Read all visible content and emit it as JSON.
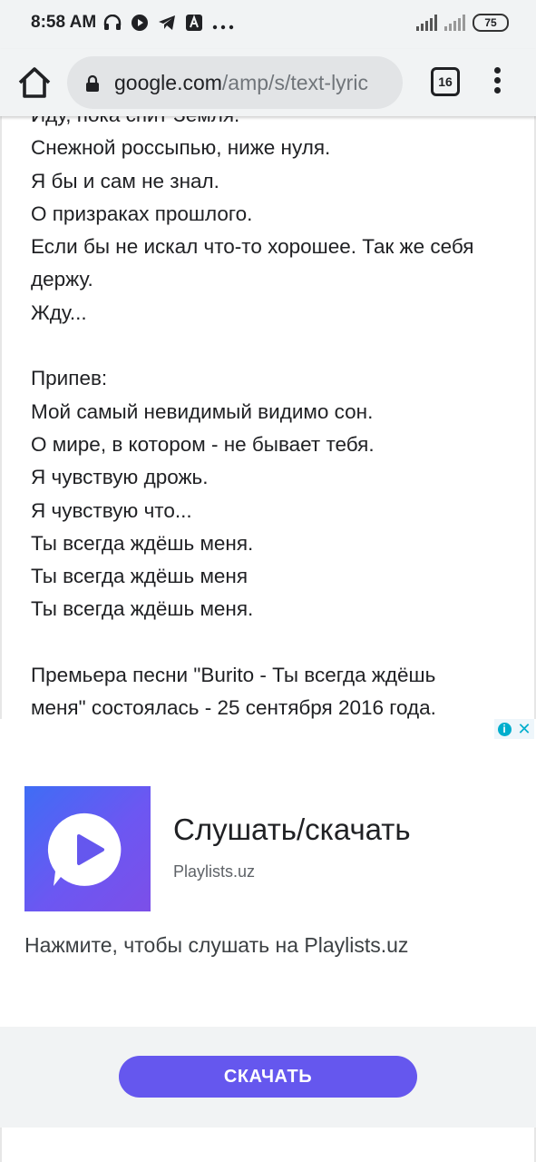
{
  "status_bar": {
    "time": "8:58 AM",
    "icons": [
      "headphones-icon",
      "play-icon",
      "telegram-icon",
      "news-icon",
      "more-icon"
    ],
    "battery": "75"
  },
  "browser": {
    "url_domain": "google.com",
    "url_path": "/amp/s/text-lyric",
    "tab_count": "16"
  },
  "lyrics": {
    "lines": [
      "Иду, пока спит Земля.",
      "Снежной россыпью, ниже нуля.",
      "Я бы и сам не знал.",
      "О призраках прошлого.",
      "Если бы не искал что-то хорошее. Так же себя",
      "держу.",
      "Жду...",
      "",
      "Припев:",
      "Мой самый невидимый видимо сон.",
      "О мире, в котором - не бывает тебя.",
      "Я чувствую дрожь.",
      "Я чувствую что...",
      "Ты всегда ждёшь меня.",
      "Ты всегда ждёшь меня",
      "Ты всегда ждёшь меня.",
      "",
      "Премьера песни \"Burito - Ты всегда ждёшь",
      "меня\" состоялась - 25 сентября 2016 года."
    ]
  },
  "ad": {
    "title": "Слушать/скачать",
    "domain": "Playlists.uz",
    "description": "Нажмите, чтобы слушать на Playlists.uz",
    "cta_label": "СКАЧАТЬ",
    "info_label": "i",
    "close_label": "✕"
  },
  "colors": {
    "cta": "#6557ee",
    "logo_gradient_start": "#3f6df5",
    "logo_gradient_end": "#7c4fe8",
    "ad_badge": "#00aecd"
  }
}
